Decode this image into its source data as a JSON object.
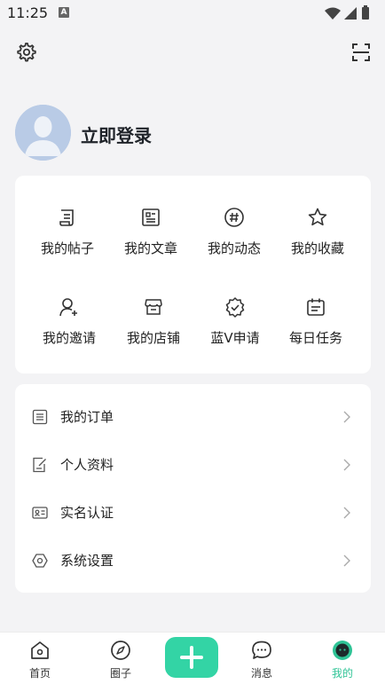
{
  "status_bar": {
    "time": "11:25",
    "notification_badge": "A"
  },
  "top_bar": {
    "settings_icon": "gear-icon",
    "scan_icon": "scan-icon"
  },
  "profile": {
    "login_text": "立即登录",
    "avatar_icon": "default-avatar"
  },
  "grid": {
    "items": [
      {
        "label": "我的帖子",
        "icon": "scroll-icon"
      },
      {
        "label": "我的文章",
        "icon": "article-icon"
      },
      {
        "label": "我的动态",
        "icon": "hashtag-icon"
      },
      {
        "label": "我的收藏",
        "icon": "star-icon"
      },
      {
        "label": "我的邀请",
        "icon": "user-plus-icon"
      },
      {
        "label": "我的店铺",
        "icon": "store-icon"
      },
      {
        "label": "蓝V申请",
        "icon": "verified-badge-icon"
      },
      {
        "label": "每日任务",
        "icon": "calendar-icon"
      }
    ]
  },
  "menu": {
    "items": [
      {
        "label": "我的订单",
        "icon": "order-list-icon"
      },
      {
        "label": "个人资料",
        "icon": "edit-document-icon"
      },
      {
        "label": "实名认证",
        "icon": "id-card-icon"
      },
      {
        "label": "系统设置",
        "icon": "hexagon-settings-icon"
      }
    ]
  },
  "tabbar": {
    "items": [
      {
        "label": "首页",
        "icon": "home-icon",
        "active": false
      },
      {
        "label": "圈子",
        "icon": "compass-icon",
        "active": false
      },
      {
        "label": "消息",
        "icon": "chat-icon",
        "active": false
      },
      {
        "label": "我的",
        "icon": "profile-face-icon",
        "active": true
      }
    ],
    "add_icon": "plus-icon"
  },
  "colors": {
    "accent": "#33d4a5",
    "active_tab_text": "#2fc496",
    "background": "#f3f3f5",
    "card": "#ffffff"
  }
}
